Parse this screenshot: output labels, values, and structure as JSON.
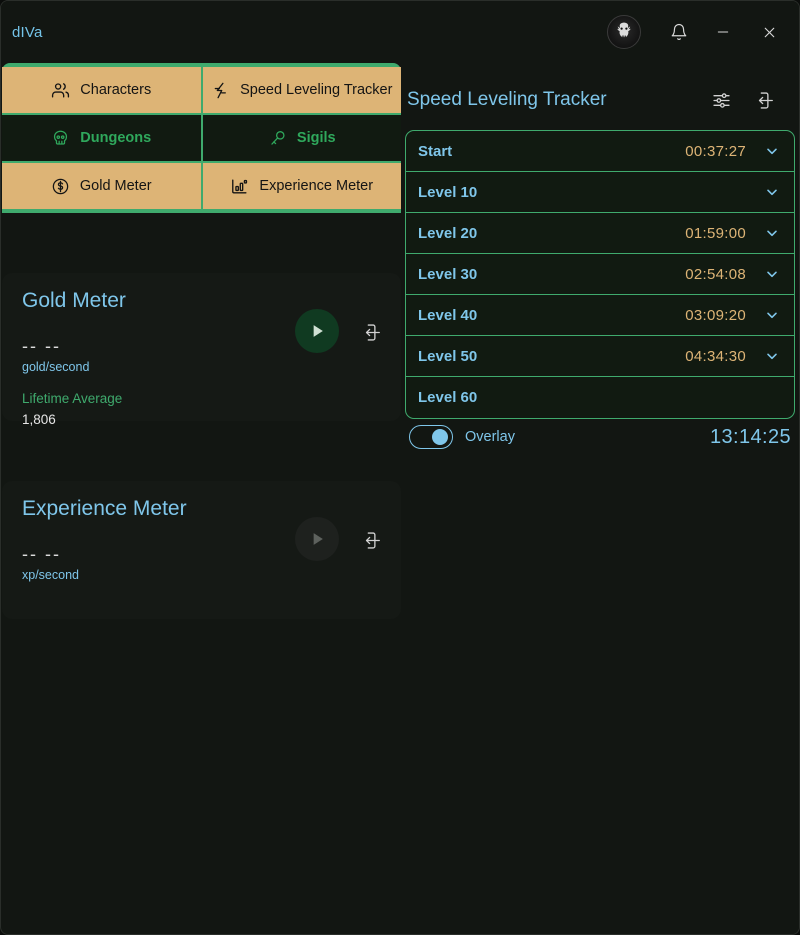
{
  "window": {
    "title": "dIVa",
    "avatar_icon": "demon-emblem-avatar",
    "notification_icon": "bell-icon",
    "minimize_icon": "minimize-icon",
    "close_icon": "close-icon"
  },
  "tabs": [
    {
      "label": "Characters",
      "icon": "users-icon",
      "active": true
    },
    {
      "label": "Speed Leveling Tracker",
      "icon": "lightning-icon",
      "active": true
    },
    {
      "label": "Dungeons",
      "icon": "skull-icon",
      "active": false
    },
    {
      "label": "Sigils",
      "icon": "key-icon",
      "active": false
    },
    {
      "label": "Gold Meter",
      "icon": "dollar-circle-icon",
      "active": true
    },
    {
      "label": "Experience Meter",
      "icon": "bar-chart-icon",
      "active": true
    }
  ],
  "meters": [
    {
      "title": "Gold Meter",
      "value": "-- --",
      "unit": "gold/second",
      "sub_label": "Lifetime Average",
      "sub_value": "1,806",
      "play_enabled": true,
      "play_icon": "play-icon",
      "popout_icon": "popout-icon"
    },
    {
      "title": "Experience Meter",
      "value": "-- --",
      "unit": "xp/second",
      "sub_label": "",
      "sub_value": "",
      "play_enabled": false,
      "play_icon": "play-icon",
      "popout_icon": "popout-icon"
    }
  ],
  "tracker": {
    "title": "Speed Leveling Tracker",
    "settings_icon": "sliders-icon",
    "popout_icon": "popout-icon",
    "rows": [
      {
        "label": "Start",
        "time": "00:37:27",
        "has_chevron": true
      },
      {
        "label": "Level 10",
        "time": "",
        "has_chevron": true
      },
      {
        "label": "Level 20",
        "time": "01:59:00",
        "has_chevron": true
      },
      {
        "label": "Level 30",
        "time": "02:54:08",
        "has_chevron": true
      },
      {
        "label": "Level 40",
        "time": "03:09:20",
        "has_chevron": true
      },
      {
        "label": "Level 50",
        "time": "04:34:30",
        "has_chevron": true
      },
      {
        "label": "Level 60",
        "time": "",
        "has_chevron": false
      }
    ],
    "overlay_label": "Overlay",
    "overlay_enabled": true,
    "session_timer": "13:14:25"
  },
  "colors": {
    "accent_blue": "#7fc6ea",
    "accent_green": "#3faa6d",
    "accent_tan": "#ddb476",
    "background": "#121612",
    "card": "#151915"
  }
}
